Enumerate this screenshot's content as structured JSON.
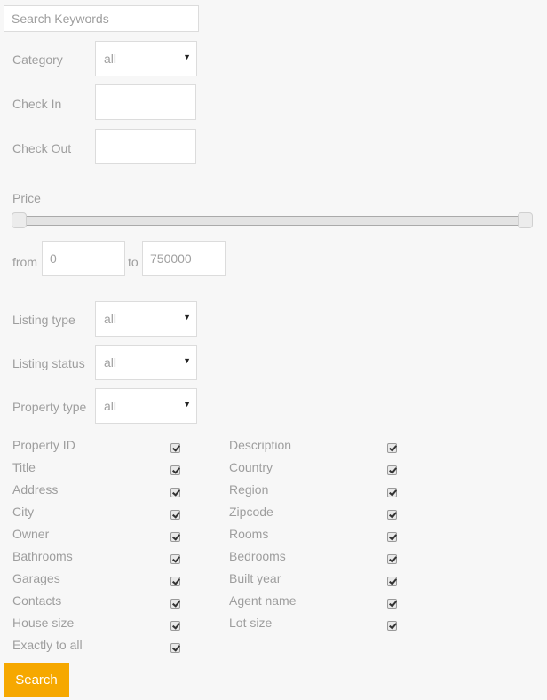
{
  "search": {
    "placeholder": "Search Keywords",
    "value": ""
  },
  "category": {
    "label": "Category",
    "value": "all"
  },
  "check_in": {
    "label": "Check In",
    "value": ""
  },
  "check_out": {
    "label": "Check Out",
    "value": ""
  },
  "price": {
    "label": "Price",
    "from_label": "from",
    "to_label": "to",
    "from_value": "0",
    "to_value": "750000",
    "slider_min_fraction": 0,
    "slider_max_fraction": 1
  },
  "listing_type": {
    "label": "Listing type",
    "value": "all"
  },
  "listing_status": {
    "label": "Listing status",
    "value": "all"
  },
  "property_type": {
    "label": "Property type",
    "value": "all"
  },
  "fields_left": [
    {
      "label": "Property ID",
      "checked": true
    },
    {
      "label": "Title",
      "checked": true
    },
    {
      "label": "Address",
      "checked": true
    },
    {
      "label": "City",
      "checked": true
    },
    {
      "label": "Owner",
      "checked": true
    },
    {
      "label": "Bathrooms",
      "checked": true
    },
    {
      "label": "Garages",
      "checked": true
    },
    {
      "label": "Contacts",
      "checked": true
    },
    {
      "label": "House size",
      "checked": true
    },
    {
      "label": "Exactly to all",
      "checked": true
    }
  ],
  "fields_right": [
    {
      "label": "Description",
      "checked": true
    },
    {
      "label": "Country",
      "checked": true
    },
    {
      "label": "Region",
      "checked": true
    },
    {
      "label": "Zipcode",
      "checked": true
    },
    {
      "label": "Rooms",
      "checked": true
    },
    {
      "label": "Bedrooms",
      "checked": true
    },
    {
      "label": "Built year",
      "checked": true
    },
    {
      "label": "Agent name",
      "checked": true
    },
    {
      "label": "Lot size",
      "checked": true
    }
  ],
  "submit_label": "Search",
  "colors": {
    "accent": "#f6a800",
    "background": "#f7f7f7",
    "text": "#9e9e9e"
  }
}
